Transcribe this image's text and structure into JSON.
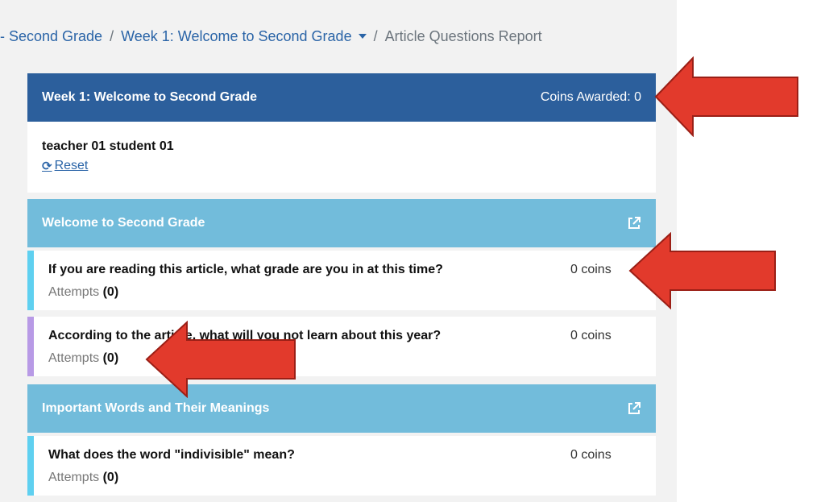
{
  "breadcrumb": {
    "course": "- Second Grade",
    "week": "Week 1: Welcome to Second Grade",
    "current": "Article Questions Report",
    "separator": "/"
  },
  "week_panel": {
    "title": "Week 1: Welcome to Second Grade",
    "coins_awarded": "Coins Awarded: 0"
  },
  "student": {
    "name": "teacher 01 student 01",
    "reset_label": "Reset",
    "reset_icon": "refresh-icon"
  },
  "sections": [
    {
      "title": "Welcome to Second Grade",
      "icon": "external-link-icon",
      "questions": [
        {
          "text": "If you are reading this article, what grade are you in at this time?",
          "coins": "0 coins",
          "attempts_label": "Attempts",
          "attempts_value": "(0)",
          "bar_color": "#5fd0f0"
        },
        {
          "text": "According to the article, what will you not learn about this year?",
          "coins": "0 coins",
          "attempts_label": "Attempts",
          "attempts_value": "(0)",
          "bar_color": "#b89ae6"
        }
      ]
    },
    {
      "title": "Important Words and Their Meanings",
      "icon": "external-link-icon",
      "questions": [
        {
          "text": "What does the word \"indivisible\" mean?",
          "coins": "0 coins",
          "attempts_label": "Attempts",
          "attempts_value": "(0)",
          "bar_color": "#5fd0f0"
        }
      ]
    }
  ],
  "colors": {
    "header_dark": "#2c5f9c",
    "header_light": "#72bcdb",
    "link": "#2a64a7",
    "annotation_arrow": "#e23a2c"
  }
}
